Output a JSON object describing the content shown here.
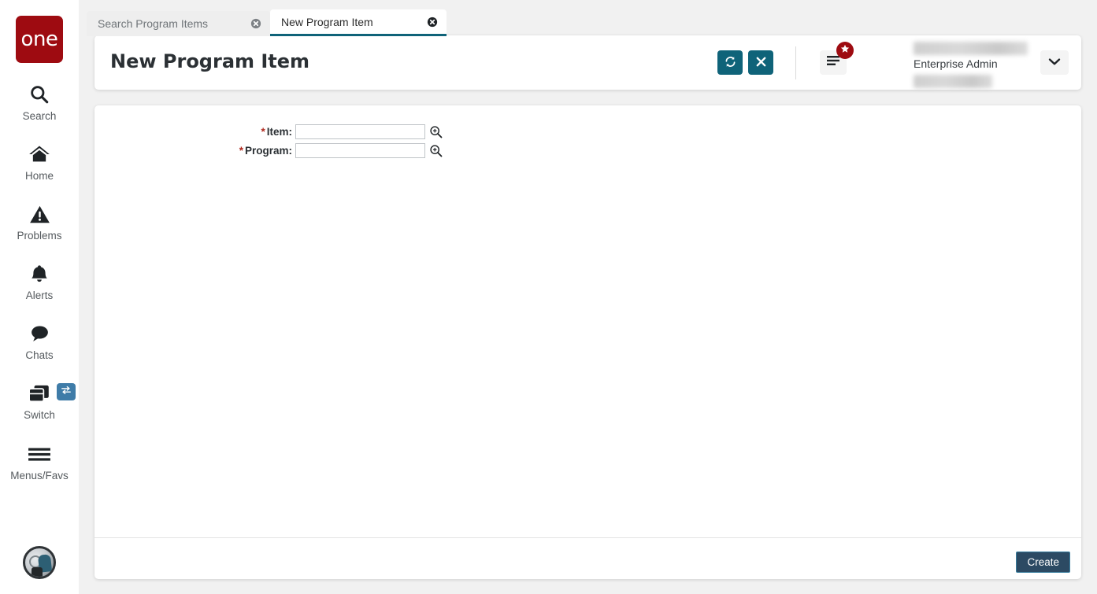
{
  "brand": {
    "logo_text": "one",
    "logo_color": "#9e0b11"
  },
  "sidebar": {
    "items": [
      {
        "label": "Search",
        "icon": "search-icon"
      },
      {
        "label": "Home",
        "icon": "home-icon"
      },
      {
        "label": "Problems",
        "icon": "warning-triangle-icon"
      },
      {
        "label": "Alerts",
        "icon": "bell-icon"
      },
      {
        "label": "Chats",
        "icon": "chat-bubble-icon"
      },
      {
        "label": "Switch",
        "icon": "switch-windows-icon"
      },
      {
        "label": "Menus/Favs",
        "icon": "hamburger-icon"
      }
    ],
    "switch_badge_icon": "swap-arrows-icon",
    "switch_badge_color": "#3f7ca8",
    "avatar_icon": "user-avatar"
  },
  "tabs": [
    {
      "label": "Search Program Items",
      "active": false,
      "close_icon": "close-circle-icon"
    },
    {
      "label": "New Program Item",
      "active": true,
      "close_icon": "close-circle-icon"
    }
  ],
  "header": {
    "title": "New Program Item",
    "accent_color": "#0f6379",
    "actions": [
      {
        "name": "refresh-button",
        "icon": "refresh-icon"
      },
      {
        "name": "close-button",
        "icon": "x-icon"
      }
    ],
    "menu_button_icon": "menu-lines-icon",
    "menu_badge_icon": "star-icon",
    "menu_badge_color": "#9e0b11",
    "user": {
      "role": "Enterprise Admin",
      "name_redacted": "",
      "org_redacted": ""
    },
    "user_dropdown_icon": "chevron-down-icon"
  },
  "form": {
    "fields": [
      {
        "label": "Item:",
        "required": true,
        "value": "",
        "placeholder": "",
        "lookup_icon": "magnifier-plus-icon"
      },
      {
        "label": "Program:",
        "required": true,
        "value": "",
        "placeholder": "",
        "lookup_icon": "magnifier-plus-icon"
      }
    ]
  },
  "footer": {
    "create_label": "Create",
    "create_bg": "#2c4a63",
    "create_border": "#3a7fa0"
  }
}
